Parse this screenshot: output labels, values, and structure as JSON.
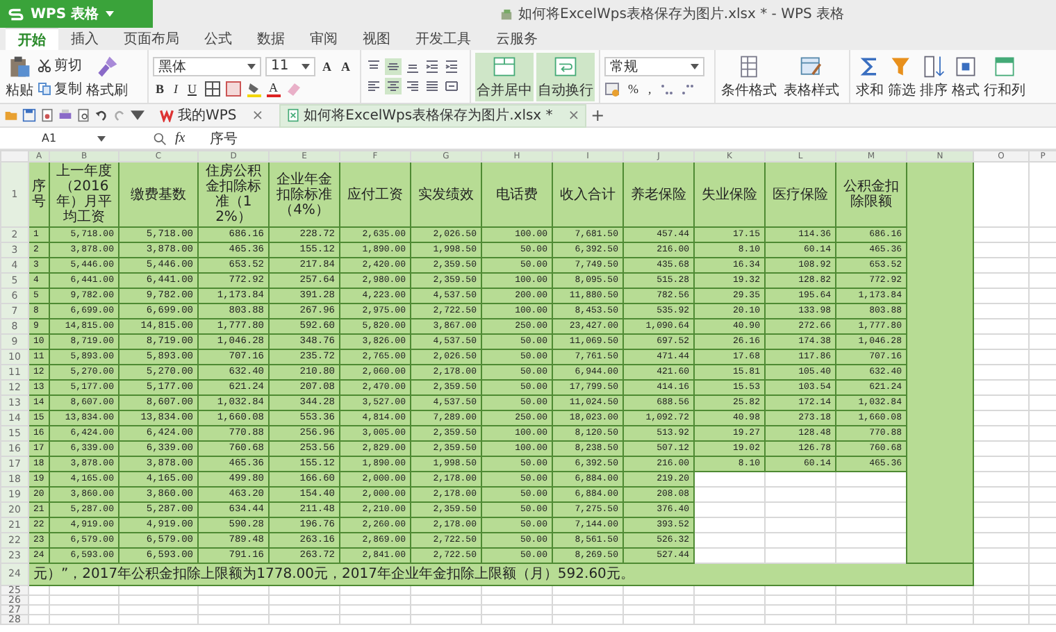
{
  "app_button": {
    "label": "WPS 表格"
  },
  "window": {
    "title": "如何将ExcelWps表格保存为图片.xlsx * - WPS 表格"
  },
  "menu_tabs": [
    {
      "label": "开始",
      "selected": true
    },
    {
      "label": "插入",
      "selected": false
    },
    {
      "label": "页面布局",
      "selected": false
    },
    {
      "label": "公式",
      "selected": false
    },
    {
      "label": "数据",
      "selected": false
    },
    {
      "label": "审阅",
      "selected": false
    },
    {
      "label": "视图",
      "selected": false
    },
    {
      "label": "开发工具",
      "selected": false
    },
    {
      "label": "云服务",
      "selected": false
    }
  ],
  "ribbon": {
    "clipboard": [
      {
        "kind": "paste",
        "label": "粘贴"
      },
      {
        "kind": "cut",
        "label": "剪切"
      },
      {
        "kind": "copy",
        "label": "复制"
      },
      {
        "kind": "painter",
        "label": "格式刷"
      }
    ],
    "font": {
      "name": "黑体",
      "size": "11",
      "grow": "A",
      "shrink": "A",
      "styles": [
        "B",
        "I",
        "U"
      ],
      "color_letter": "A"
    },
    "alignment": [
      {
        "kind": "top",
        "selected": false
      },
      {
        "kind": "middle",
        "selected": true
      },
      {
        "kind": "bottom",
        "selected": false
      },
      {
        "kind": "indent",
        "selected": false
      },
      {
        "kind": "indent",
        "selected": false
      },
      {
        "kind": "left",
        "selected": false
      },
      {
        "kind": "center",
        "selected": true
      },
      {
        "kind": "right",
        "selected": false
      },
      {
        "kind": "justify",
        "selected": false
      },
      {
        "kind": "distributed",
        "selected": false
      }
    ],
    "merge": {
      "label": "合并居中",
      "selected": true
    },
    "wrap": {
      "label": "自动换行",
      "selected": true
    },
    "number": {
      "format": "常规",
      "percent": "%",
      "comma": ","
    },
    "styles": [
      {
        "kind": "conditional",
        "label": "条件格式"
      },
      {
        "kind": "table-style",
        "label": "表格样式"
      }
    ],
    "editing": [
      {
        "kind": "sum",
        "label": "求和"
      },
      {
        "kind": "filter",
        "label": "筛选"
      },
      {
        "kind": "sort",
        "label": "排序"
      },
      {
        "kind": "format",
        "label": "格式"
      },
      {
        "kind": "rows-cols",
        "label": "行和列"
      }
    ]
  },
  "doc_tabs": [
    {
      "kind": "home",
      "label": "我的WPS",
      "close": "×",
      "selected": false
    },
    {
      "kind": "file",
      "label": "如何将ExcelWps表格保存为图片.xlsx *",
      "close": "×",
      "selected": true
    }
  ],
  "new_tab": "+",
  "formula_bar": {
    "cell_ref": "A1",
    "fx": "fx",
    "content": "序号"
  },
  "columns": [
    {
      "label": "A",
      "selected": true
    },
    {
      "label": "B",
      "selected": true
    },
    {
      "label": "C",
      "selected": true
    },
    {
      "label": "D",
      "selected": true
    },
    {
      "label": "E",
      "selected": true
    },
    {
      "label": "F",
      "selected": true
    },
    {
      "label": "G",
      "selected": true
    },
    {
      "label": "H",
      "selected": true
    },
    {
      "label": "I",
      "selected": true
    },
    {
      "label": "J",
      "selected": true
    },
    {
      "label": "K",
      "selected": true
    },
    {
      "label": "L",
      "selected": true
    },
    {
      "label": "M",
      "selected": true
    },
    {
      "label": "N",
      "selected": true
    },
    {
      "label": "O",
      "selected": false
    },
    {
      "label": "P",
      "selected": false
    }
  ],
  "header_row": {
    "number": "1",
    "cells": [
      "序号",
      "上一年度（2016年）月平均工资",
      "缴费基数",
      "住房公积金扣除标准（12%）",
      "企业年金扣除标准（4%）",
      "应付工资",
      "实发绩效",
      "电话费",
      "收入合计",
      "养老保险",
      "失业保险",
      "医疗保险",
      "公积金扣除限额"
    ]
  },
  "rows": [
    {
      "number": "2",
      "cells": [
        "1",
        "5,718.00",
        "5,718.00",
        "686.16",
        "228.72",
        "2,635.00",
        "2,026.50",
        "100.00",
        "7,681.50",
        "457.44",
        "17.15",
        "114.36",
        "686.16"
      ]
    },
    {
      "number": "3",
      "cells": [
        "2",
        "3,878.00",
        "3,878.00",
        "465.36",
        "155.12",
        "1,890.00",
        "1,998.50",
        "50.00",
        "6,392.50",
        "216.00",
        "8.10",
        "60.14",
        "465.36"
      ]
    },
    {
      "number": "4",
      "cells": [
        "3",
        "5,446.00",
        "5,446.00",
        "653.52",
        "217.84",
        "2,420.00",
        "2,359.50",
        "50.00",
        "7,749.50",
        "435.68",
        "16.34",
        "108.92",
        "653.52"
      ]
    },
    {
      "number": "5",
      "cells": [
        "4",
        "6,441.00",
        "6,441.00",
        "772.92",
        "257.64",
        "2,980.00",
        "2,359.50",
        "100.00",
        "8,095.50",
        "515.28",
        "19.32",
        "128.82",
        "772.92"
      ]
    },
    {
      "number": "6",
      "cells": [
        "5",
        "9,782.00",
        "9,782.00",
        "1,173.84",
        "391.28",
        "4,223.00",
        "4,537.50",
        "200.00",
        "11,880.50",
        "782.56",
        "29.35",
        "195.64",
        "1,173.84"
      ]
    },
    {
      "number": "7",
      "cells": [
        "8",
        "6,699.00",
        "6,699.00",
        "803.88",
        "267.96",
        "2,975.00",
        "2,722.50",
        "100.00",
        "8,453.50",
        "535.92",
        "20.10",
        "133.98",
        "803.88"
      ]
    },
    {
      "number": "8",
      "cells": [
        "9",
        "14,815.00",
        "14,815.00",
        "1,777.80",
        "592.60",
        "5,820.00",
        "3,867.00",
        "250.00",
        "23,427.00",
        "1,090.64",
        "40.90",
        "272.66",
        "1,777.80"
      ]
    },
    {
      "number": "9",
      "cells": [
        "10",
        "8,719.00",
        "8,719.00",
        "1,046.28",
        "348.76",
        "3,826.00",
        "4,537.50",
        "50.00",
        "11,069.50",
        "697.52",
        "26.16",
        "174.38",
        "1,046.28"
      ]
    },
    {
      "number": "10",
      "cells": [
        "11",
        "5,893.00",
        "5,893.00",
        "707.16",
        "235.72",
        "2,765.00",
        "2,026.50",
        "50.00",
        "7,761.50",
        "471.44",
        "17.68",
        "117.86",
        "707.16"
      ]
    },
    {
      "number": "11",
      "cells": [
        "12",
        "5,270.00",
        "5,270.00",
        "632.40",
        "210.80",
        "2,060.00",
        "2,178.00",
        "50.00",
        "6,944.00",
        "421.60",
        "15.81",
        "105.40",
        "632.40"
      ]
    },
    {
      "number": "12",
      "cells": [
        "13",
        "5,177.00",
        "5,177.00",
        "621.24",
        "207.08",
        "2,470.00",
        "2,359.50",
        "50.00",
        "17,799.50",
        "414.16",
        "15.53",
        "103.54",
        "621.24"
      ]
    },
    {
      "number": "13",
      "cells": [
        "14",
        "8,607.00",
        "8,607.00",
        "1,032.84",
        "344.28",
        "3,527.00",
        "4,537.50",
        "50.00",
        "11,024.50",
        "688.56",
        "25.82",
        "172.14",
        "1,032.84"
      ]
    },
    {
      "number": "14",
      "cells": [
        "15",
        "13,834.00",
        "13,834.00",
        "1,660.08",
        "553.36",
        "4,814.00",
        "7,289.00",
        "250.00",
        "18,023.00",
        "1,092.72",
        "40.98",
        "273.18",
        "1,660.08"
      ]
    },
    {
      "number": "15",
      "cells": [
        "16",
        "6,424.00",
        "6,424.00",
        "770.88",
        "256.96",
        "3,005.00",
        "2,359.50",
        "100.00",
        "8,120.50",
        "513.92",
        "19.27",
        "128.48",
        "770.88"
      ]
    },
    {
      "number": "16",
      "cells": [
        "17",
        "6,339.00",
        "6,339.00",
        "760.68",
        "253.56",
        "2,829.00",
        "2,359.50",
        "100.00",
        "8,238.50",
        "507.12",
        "19.02",
        "126.78",
        "760.68"
      ]
    },
    {
      "number": "17",
      "cells": [
        "18",
        "3,878.00",
        "3,878.00",
        "465.36",
        "155.12",
        "1,890.00",
        "1,998.50",
        "50.00",
        "6,392.50",
        "216.00",
        "8.10",
        "60.14",
        "465.36"
      ]
    },
    {
      "number": "18",
      "cells": [
        "19",
        "4,165.00",
        "4,165.00",
        "499.80",
        "166.60",
        "2,000.00",
        "2,178.00",
        "50.00",
        "6,884.00",
        "219.20"
      ]
    },
    {
      "number": "19",
      "cells": [
        "20",
        "3,860.00",
        "3,860.00",
        "463.20",
        "154.40",
        "2,000.00",
        "2,178.00",
        "50.00",
        "6,884.00",
        "208.08"
      ]
    },
    {
      "number": "20",
      "cells": [
        "21",
        "5,287.00",
        "5,287.00",
        "634.44",
        "211.48",
        "2,210.00",
        "2,359.50",
        "50.00",
        "7,275.50",
        "376.40"
      ]
    },
    {
      "number": "21",
      "cells": [
        "22",
        "4,919.00",
        "4,919.00",
        "590.28",
        "196.76",
        "2,260.00",
        "2,178.00",
        "50.00",
        "7,144.00",
        "393.52"
      ]
    },
    {
      "number": "22",
      "cells": [
        "23",
        "6,579.00",
        "6,579.00",
        "789.48",
        "263.16",
        "2,869.00",
        "2,722.50",
        "50.00",
        "8,561.50",
        "526.32"
      ]
    },
    {
      "number": "23",
      "cells": [
        "24",
        "6,593.00",
        "6,593.00",
        "791.16",
        "263.72",
        "2,841.00",
        "2,722.50",
        "50.00",
        "8,269.50",
        "527.44"
      ]
    }
  ],
  "note_row": {
    "number": "24",
    "text": "元）”，2017年公积金扣除上限额为1778.00元，2017年企业年金扣除上限额（月）592.60元。"
  },
  "empty_rows": [
    "25",
    "26",
    "27",
    "28"
  ]
}
